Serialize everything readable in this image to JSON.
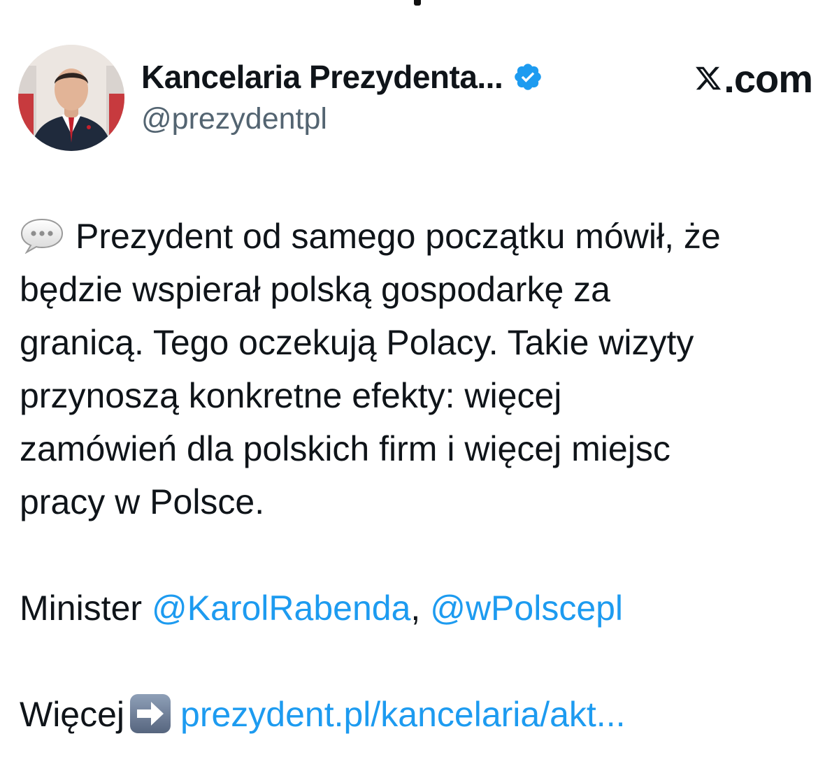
{
  "author": {
    "display_name": "Kancelaria Prezydenta...",
    "handle": "@prezydentpl",
    "verified": true
  },
  "source_mark": {
    "text": ".com",
    "icon": "x-logo-icon"
  },
  "tweet": {
    "icon": "speech-bubble-icon",
    "lines": [
      "Prezydent od samego początku mówił, że",
      "będzie wspierał polską gospodarkę za",
      "granicą. Tego oczekują Polacy. Takie wizyty",
      "przynoszą konkretne efekty: więcej",
      "zamówień dla polskich firm i więcej miejsc",
      "pracy w Polsce."
    ],
    "minister_label": "Minister",
    "mention_1": "@KarolRabenda",
    "separator": ",",
    "mention_2": "@wPolscepl",
    "more_label": "Więcej",
    "arrow_icon": "right-arrow-icon",
    "link_text": "prezydent.pl/kancelaria/akt..."
  },
  "colors": {
    "text": "#0f1419",
    "secondary": "#536471",
    "link": "#1d9bf0",
    "verified": "#1d9bf0"
  }
}
